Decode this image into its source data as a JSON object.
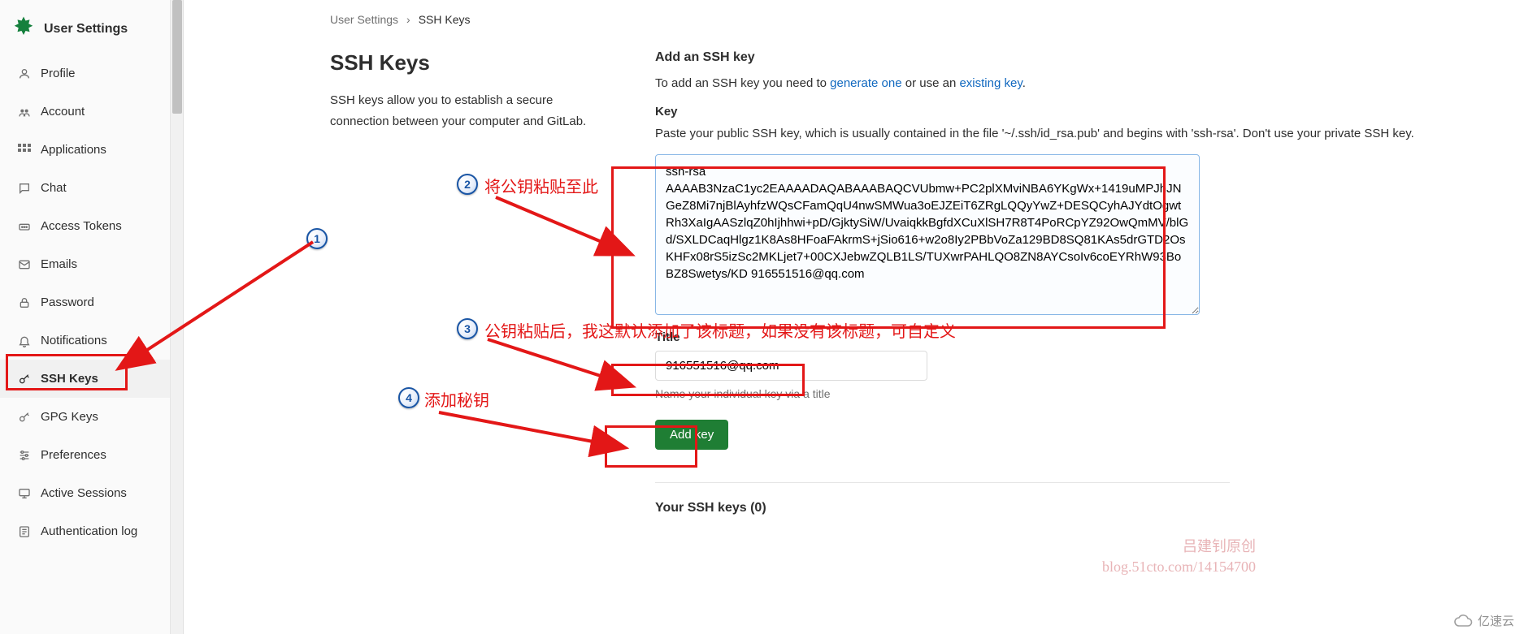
{
  "sidebar": {
    "title": "User Settings",
    "items": [
      {
        "label": "Profile",
        "active": false
      },
      {
        "label": "Account",
        "active": false
      },
      {
        "label": "Applications",
        "active": false
      },
      {
        "label": "Chat",
        "active": false
      },
      {
        "label": "Access Tokens",
        "active": false
      },
      {
        "label": "Emails",
        "active": false
      },
      {
        "label": "Password",
        "active": false
      },
      {
        "label": "Notifications",
        "active": false
      },
      {
        "label": "SSH Keys",
        "active": true
      },
      {
        "label": "GPG Keys",
        "active": false
      },
      {
        "label": "Preferences",
        "active": false
      },
      {
        "label": "Active Sessions",
        "active": false
      },
      {
        "label": "Authentication log",
        "active": false
      }
    ]
  },
  "breadcrumb": {
    "root": "User Settings",
    "sep": "›",
    "current": "SSH Keys"
  },
  "main": {
    "heading": "SSH Keys",
    "description": "SSH keys allow you to establish a secure connection between your computer and GitLab.",
    "add_heading": "Add an SSH key",
    "add_help_pre": "To add an SSH key you need to ",
    "add_help_link1": "generate one",
    "add_help_mid": " or use an ",
    "add_help_link2": "existing key",
    "add_help_post": ".",
    "key_label": "Key",
    "key_help": "Paste your public SSH key, which is usually contained in the file '~/.ssh/id_rsa.pub' and begins with 'ssh-rsa'. Don't use your private SSH key.",
    "key_value": "ssh-rsa AAAAB3NzaC1yc2EAAAADAQABAAABAQCVUbmw+PC2plXMviNBA6YKgWx+1419uMPJhJNGeZ8Mi7njBlAyhfzWQsCFamQqU4nwSMWua3oEJZEiT6ZRgLQQyYwZ+DESQCyhAJYdtOgwtRh3XaIgAASzlqZ0hIjhhwi+pD/GjktySiW/UvaiqkkBgfdXCuXlSH7R8T4PoRCpYZ92OwQmMV/blGd/SXLDCaqHlgz1K8As8HFoaFAkrmS+jSio616+w2o8Iy2PBbVoZa129BD8SQ81KAs5drGTD2OsKHFx08rS5izSc2MKLjet7+00CXJebwZQLB1LS/TUXwrPAHLQO8ZN8AYCsoIv6coEYRhW93BoBZ8Swetys/KD 916551516@qq.com",
    "title_label": "Title",
    "title_value": "916551516@qq.com",
    "title_help": "Name your individual key via a title",
    "add_button": "Add key",
    "list_heading": "Your SSH keys (0)"
  },
  "annotations": {
    "step1_text": "",
    "step2_text": "将公钥粘贴至此",
    "step3_text": "公钥粘贴后，我这默认添加了该标题，如果没有该标题，可自定义",
    "step4_text": "添加秘钥"
  },
  "watermark": {
    "line1": "吕建钊原创",
    "line2": "blog.51cto.com/14154700",
    "brand": "亿速云"
  }
}
